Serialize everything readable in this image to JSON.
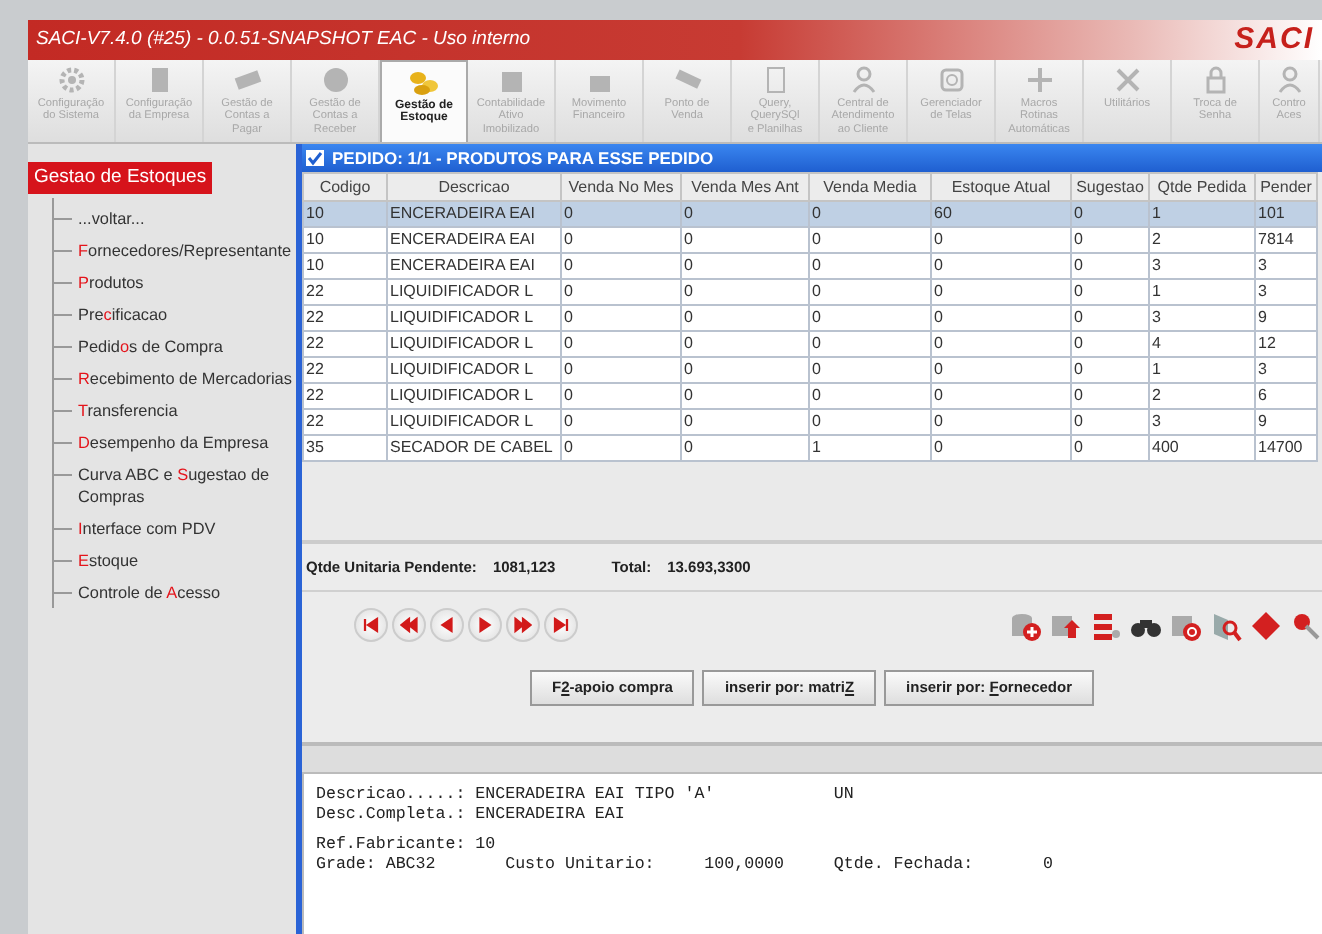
{
  "app": {
    "title": "SACI-V7.4.0 (#25) - 0.0.51-SNAPSHOT  EAC - Uso interno",
    "logo": "SACI"
  },
  "toolbar": [
    {
      "lines": [
        "Configuração",
        "do Sistema"
      ],
      "selected": false,
      "disabled": true
    },
    {
      "lines": [
        "Configuração",
        "da Empresa"
      ],
      "selected": false,
      "disabled": true
    },
    {
      "lines": [
        "Gestão de",
        "Contas a",
        "Pagar"
      ],
      "selected": false,
      "disabled": true
    },
    {
      "lines": [
        "Gestão de",
        "Contas a",
        "Receber"
      ],
      "selected": false,
      "disabled": true
    },
    {
      "lines": [
        "Gestão de",
        "Estoque"
      ],
      "selected": true,
      "disabled": false
    },
    {
      "lines": [
        "Contabilidade",
        "Ativo",
        "Imobilizado"
      ],
      "selected": false,
      "disabled": true
    },
    {
      "lines": [
        "Movimento",
        "Financeiro"
      ],
      "selected": false,
      "disabled": true
    },
    {
      "lines": [
        "Ponto de",
        "Venda"
      ],
      "selected": false,
      "disabled": true
    },
    {
      "lines": [
        "Query,",
        "QuerySQl",
        "e Planilhas"
      ],
      "selected": false,
      "disabled": true
    },
    {
      "lines": [
        "Central de",
        "Atendimento",
        "ao Cliente"
      ],
      "selected": false,
      "disabled": true
    },
    {
      "lines": [
        "Gerenciador",
        "de Telas"
      ],
      "selected": false,
      "disabled": true
    },
    {
      "lines": [
        "Macros",
        "Rotinas",
        "Automáticas"
      ],
      "selected": false,
      "disabled": true
    },
    {
      "lines": [
        "Utilitários"
      ],
      "selected": false,
      "disabled": true
    },
    {
      "lines": [
        "Troca de",
        "Senha"
      ],
      "selected": false,
      "disabled": true
    },
    {
      "lines": [
        "Contro",
        "Aces"
      ],
      "selected": false,
      "disabled": true
    }
  ],
  "sidebar": {
    "title": "Gestao de Estoques",
    "items": [
      {
        "pre": "...voltar..."
      },
      {
        "key": "F",
        "post": "ornecedores/Representante"
      },
      {
        "key": "P",
        "post": "rodutos"
      },
      {
        "pre": "Pre",
        "key": "c",
        "post": "ificacao"
      },
      {
        "pre": "Pedid",
        "key": "o",
        "post": "s de Compra"
      },
      {
        "key": "R",
        "post": "ecebimento de Mercadorias"
      },
      {
        "key": "T",
        "post": "ransferencia"
      },
      {
        "key": "D",
        "post": "esempenho da Empresa"
      },
      {
        "pre": "Curva ABC e ",
        "key": "S",
        "post": "ugestao de Compras"
      },
      {
        "key": "I",
        "post": "nterface com PDV"
      },
      {
        "key": "E",
        "post": "stoque"
      },
      {
        "pre": "Controle de ",
        "key": "A",
        "post": "cesso"
      }
    ]
  },
  "dialog": {
    "title": "PEDIDO: 1/1  -  PRODUTOS PARA ESSE PEDIDO",
    "table": {
      "columns": [
        "Codigo",
        "Descricao",
        "Venda No Mes",
        "Venda Mes Ant",
        "Venda  Media",
        "Estoque  Atual",
        "Sugestao",
        "Qtde Pedida",
        "Pender"
      ],
      "rows": [
        {
          "selected": true,
          "cells": [
            "10",
            "ENCERADEIRA EAI",
            "0",
            "0",
            "0",
            "60",
            "0",
            "1",
            "101"
          ]
        },
        {
          "selected": false,
          "cells": [
            "10",
            "ENCERADEIRA EAI",
            "0",
            "0",
            "0",
            "0",
            "0",
            "2",
            "7814"
          ]
        },
        {
          "selected": false,
          "cells": [
            "10",
            "ENCERADEIRA EAI",
            "0",
            "0",
            "0",
            "0",
            "0",
            "3",
            "3"
          ]
        },
        {
          "selected": false,
          "cells": [
            "22",
            "LIQUIDIFICADOR L",
            "0",
            "0",
            "0",
            "0",
            "0",
            "1",
            "3"
          ]
        },
        {
          "selected": false,
          "cells": [
            "22",
            "LIQUIDIFICADOR L",
            "0",
            "0",
            "0",
            "0",
            "0",
            "3",
            "9"
          ]
        },
        {
          "selected": false,
          "cells": [
            "22",
            "LIQUIDIFICADOR L",
            "0",
            "0",
            "0",
            "0",
            "0",
            "4",
            "12"
          ]
        },
        {
          "selected": false,
          "cells": [
            "22",
            "LIQUIDIFICADOR L",
            "0",
            "0",
            "0",
            "0",
            "0",
            "1",
            "3"
          ]
        },
        {
          "selected": false,
          "cells": [
            "22",
            "LIQUIDIFICADOR L",
            "0",
            "0",
            "0",
            "0",
            "0",
            "2",
            "6"
          ]
        },
        {
          "selected": false,
          "cells": [
            "22",
            "LIQUIDIFICADOR L",
            "0",
            "0",
            "0",
            "0",
            "0",
            "3",
            "9"
          ]
        },
        {
          "selected": false,
          "cells": [
            "35",
            "SECADOR DE CABEL",
            "0",
            "0",
            "1",
            "0",
            "0",
            "400",
            "14700"
          ]
        }
      ]
    },
    "summary": [
      {
        "label": "Qtde Unitaria Pendente:",
        "value": "1081,123"
      },
      {
        "label": "Total:",
        "value": "13.693,3300"
      }
    ],
    "buttons": [
      {
        "pre": "F",
        "key": "2",
        "post": "-apoio compra"
      },
      {
        "pre": "inserir por: matri",
        "key": "Z"
      },
      {
        "pre": "inserir por: ",
        "key": "F",
        "post": "ornecedor"
      }
    ],
    "details": [
      [
        "Descricao.....: ENCERADEIRA EAI TIPO 'A'            UN",
        "Desc.Completa.: ENCERADEIRA EAI"
      ],
      [
        "Ref.Fabricante: 10",
        "Grade: ABC32       Custo Unitario:     100,0000     Qtde. Fechada:       0"
      ]
    ]
  }
}
